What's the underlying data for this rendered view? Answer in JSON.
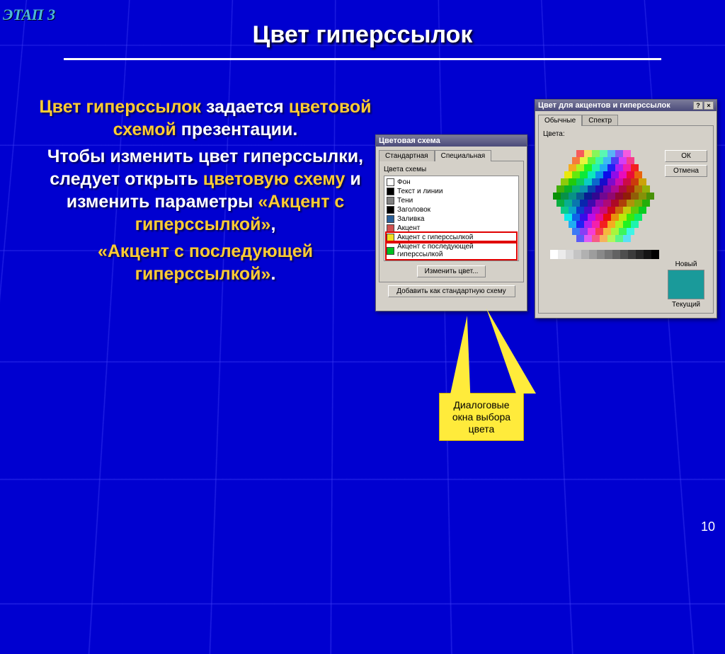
{
  "corner_logo": "ЭТАП 3",
  "slide_title": "Цвет гиперссылок",
  "page_number": "10",
  "body": {
    "p1a": "Цвет гиперссылок",
    "p1b": " задается ",
    "p1c": "цветовой схемой",
    "p1d": " презентации.",
    "p2a": "Чтобы изменить цвет гиперссылки, следует открыть ",
    "p2b": "цветовую схему",
    "p2c": " и изменить параметры ",
    "p2d": "«Акцент с гиперссылкой»",
    "p2e": ",",
    "p3a": "«Акцент с последующей гиперссылкой»",
    "p3b": "."
  },
  "dlg1": {
    "title": "Цветовая схема",
    "tab1": "Стандартная",
    "tab2": "Специальная",
    "group": "Цвета схемы",
    "items": [
      {
        "label": "Фон",
        "color": "#ffffff"
      },
      {
        "label": "Текст и линии",
        "color": "#000000"
      },
      {
        "label": "Тени",
        "color": "#808080"
      },
      {
        "label": "Заголовок",
        "color": "#000000"
      },
      {
        "label": "Заливка",
        "color": "#2a6099"
      },
      {
        "label": "Акцент",
        "color": "#d05050"
      },
      {
        "label": "Акцент с гиперссылкой",
        "color": "#f0e020"
      },
      {
        "label": "Акцент с последующей гиперссылкой",
        "color": "#00c020"
      }
    ],
    "btn_change": "Изменить цвет...",
    "btn_add": "Добавить как стандартную схему"
  },
  "dlg2": {
    "title": "Цвет для акцентов и гиперссылок",
    "tab1": "Обычные",
    "tab2": "Спектр",
    "label_colors": "Цвета:",
    "btn_ok": "ОК",
    "btn_cancel": "Отмена",
    "label_new": "Новый",
    "label_current": "Текущий",
    "swatch_new": "#1a9a9a",
    "swatch_current": "#1a9a9a"
  },
  "callout": "Диалоговые окна выбора цвета"
}
